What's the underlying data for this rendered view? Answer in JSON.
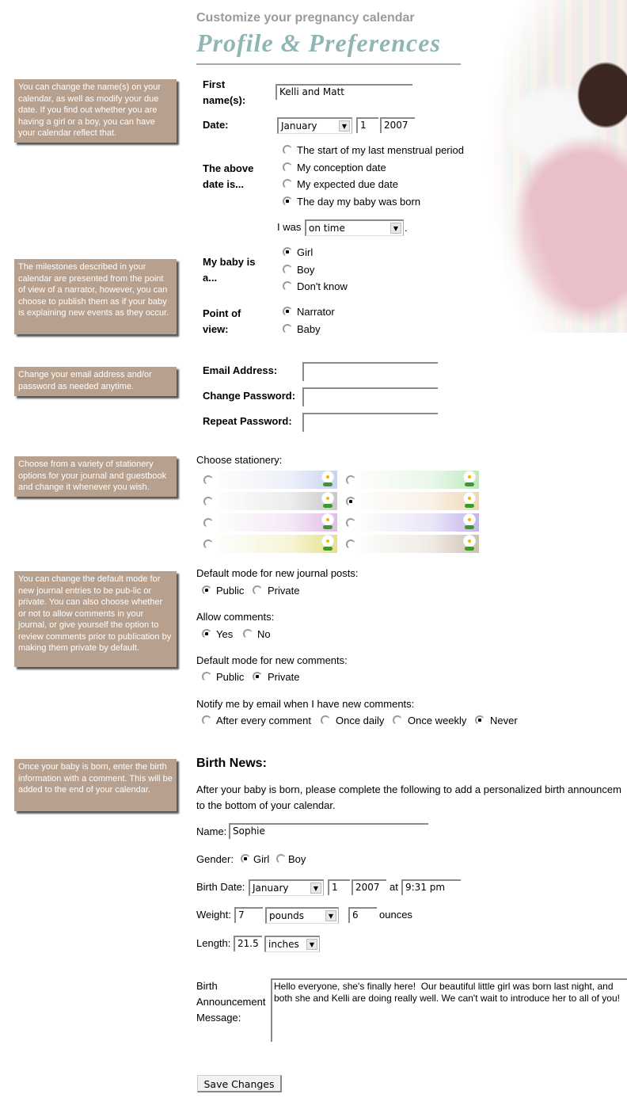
{
  "header": {
    "subtitle": "Customize your pregnancy calendar",
    "title": "Profile & Preferences"
  },
  "notes": [
    "You can change the name(s) on your calendar, as well as modify your due date. If you find out whether you are having a girl or a boy, you can have your calendar reflect that.",
    "The milestones described in your calendar are presented from the point of view of a narrator, however, you can choose to publish them as if your baby is explaining new events as they occur.",
    "Change your email address and/or password as needed anytime.",
    "Choose from a variety of stationery options for your journal and guestbook and change it whenever you wish.",
    "You can change the default mode for new journal entries to be pub-lic or private. You can also choose whether or not to allow comments in your journal, or give yourself the option to review comments prior to publication by making them private by default.",
    "Once your baby is born, enter the birth information with a comment. This will be added to the end of your calendar."
  ],
  "profile": {
    "first_names_label": "First name(s):",
    "first_names_value": "Kelli and Matt",
    "date_label": "Date:",
    "date_month": "January",
    "date_day": "1",
    "date_year": "2007",
    "date_is_label": "The above date is...",
    "date_options": [
      {
        "label": "The start of my last menstrual period",
        "checked": false
      },
      {
        "label": "My conception date",
        "checked": false
      },
      {
        "label": "My expected due date",
        "checked": false
      },
      {
        "label": "The day my baby was born",
        "checked": true
      }
    ],
    "i_was_label": "I was",
    "i_was_value": "on time",
    "i_was_suffix": ".",
    "baby_is_label": "My baby is a...",
    "baby_options": [
      {
        "label": "Girl",
        "checked": true
      },
      {
        "label": "Boy",
        "checked": false
      },
      {
        "label": "Don't know",
        "checked": false
      }
    ],
    "pov_label": "Point of view:",
    "pov_options": [
      {
        "label": "Narrator",
        "checked": true
      },
      {
        "label": "Baby",
        "checked": false
      }
    ]
  },
  "account": {
    "email_label": "Email Address:",
    "email_value": "",
    "password_label": "Change Password:",
    "password_value": "",
    "repeat_label": "Repeat Password:",
    "repeat_value": ""
  },
  "stationery": {
    "label": "Choose stationery:",
    "options": [
      {
        "name": "blue",
        "color": "#c9d3f0",
        "checked": false
      },
      {
        "name": "green",
        "color": "#bfe8bd",
        "checked": false
      },
      {
        "name": "gray",
        "color": "#c8c8c8",
        "checked": false
      },
      {
        "name": "peach",
        "color": "#eed6b6",
        "checked": true
      },
      {
        "name": "pink",
        "color": "#dfbde6",
        "checked": false
      },
      {
        "name": "lavender",
        "color": "#c3b5ea",
        "checked": false
      },
      {
        "name": "yellow",
        "color": "#e5e08a",
        "checked": false
      },
      {
        "name": "taupe",
        "color": "#cfc0b0",
        "checked": false
      }
    ]
  },
  "journal": {
    "posts_label": "Default mode for new journal posts:",
    "posts_options": [
      {
        "label": "Public",
        "checked": true
      },
      {
        "label": "Private",
        "checked": false
      }
    ],
    "allow_label": "Allow comments:",
    "allow_options": [
      {
        "label": "Yes",
        "checked": true
      },
      {
        "label": "No",
        "checked": false
      }
    ],
    "comments_label": "Default mode for new comments:",
    "comments_options": [
      {
        "label": "Public",
        "checked": false
      },
      {
        "label": "Private",
        "checked": true
      }
    ],
    "notify_label": "Notify me by email when I have new comments:",
    "notify_options": [
      {
        "label": "After every comment",
        "checked": false
      },
      {
        "label": "Once daily",
        "checked": false
      },
      {
        "label": "Once weekly",
        "checked": false
      },
      {
        "label": "Never",
        "checked": true
      }
    ]
  },
  "birth": {
    "heading": "Birth News:",
    "intro": "After your baby is born, please complete the following to add a personalized birth announcem to the bottom of your calendar.",
    "name_label": "Name:",
    "name_value": "Sophie",
    "gender_label": "Gender:",
    "gender_options": [
      {
        "label": "Girl",
        "checked": true
      },
      {
        "label": "Boy",
        "checked": false
      }
    ],
    "date_label": "Birth Date:",
    "month": "January",
    "day": "1",
    "year": "2007",
    "at_label": "at",
    "time": "9:31 pm",
    "weight_label": "Weight:",
    "weight_value": "7",
    "weight_unit": "pounds",
    "ounces_value": "6",
    "ounces_label": "ounces",
    "length_label": "Length:",
    "length_value": "21.5",
    "length_unit": "inches",
    "message_label": "Birth Announcement Message:",
    "message_value": "Hello everyone, she's finally here!  Our beautiful little girl was born last night, and both she and Kelli are doing really well. We can't wait to introduce her to all of you!"
  },
  "save_label": "Save Changes"
}
